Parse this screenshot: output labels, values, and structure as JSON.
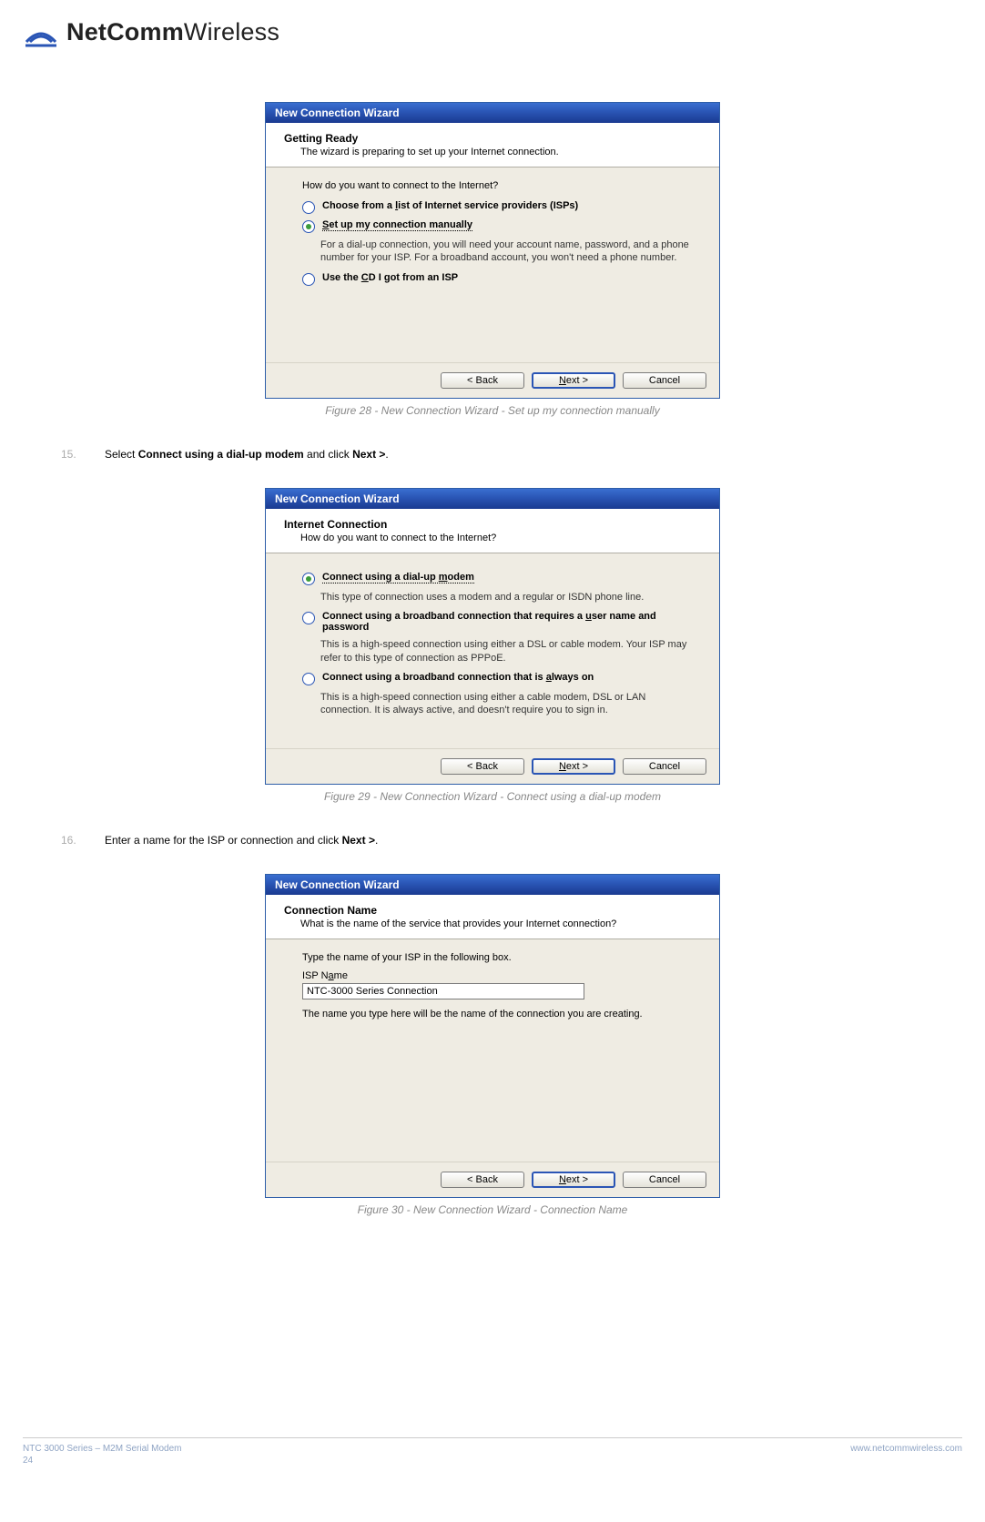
{
  "logo": {
    "bold": "NetComm",
    "light": "Wireless"
  },
  "figure28": {
    "caption": "Figure 28 - New Connection Wizard - Set up my connection manually",
    "titlebar": "New Connection Wizard",
    "head_title": "Getting Ready",
    "head_sub": "The wizard is preparing to set up your Internet connection.",
    "prompt": "How do you want to connect to the Internet?",
    "opt1_pre": "Choose from a ",
    "opt1_u": "l",
    "opt1_post": "ist of Internet service providers (ISPs)",
    "opt2_u": "S",
    "opt2_post": "et up my connection manually",
    "opt2_sub": "For a dial-up connection, you will need your account name, password, and a phone number for your ISP. For a broadband account, you won't need a phone number.",
    "opt3_pre": "Use the ",
    "opt3_u": "C",
    "opt3_post": "D I got from an ISP",
    "back": "< Back",
    "next": "Next >",
    "cancel": "Cancel"
  },
  "step15": {
    "num": "15.",
    "pre": "Select ",
    "b1": "Connect using a dial-up modem",
    "mid": " and click ",
    "b2": "Next >",
    "post": "."
  },
  "figure29": {
    "caption": "Figure 29 - New Connection Wizard - Connect using a dial-up modem",
    "titlebar": "New Connection Wizard",
    "head_title": "Internet Connection",
    "head_sub": "How do you want to connect to the Internet?",
    "opt1_pre": "Connect using a dial-up ",
    "opt1_u": "m",
    "opt1_post": "odem",
    "opt1_sub": "This type of connection uses a modem and a regular or ISDN phone line.",
    "opt2_pre": "Connect using a broadband connection that requires a ",
    "opt2_u": "u",
    "opt2_post": "ser name and password",
    "opt2_sub": "This is a high-speed connection using either a DSL or cable modem. Your ISP may refer to this type of connection as PPPoE.",
    "opt3_pre": "Connect using a broadband connection that is ",
    "opt3_u": "a",
    "opt3_post": "lways on",
    "opt3_sub": "This is a high-speed connection using either a cable modem, DSL or LAN connection. It is always active, and doesn't require you to sign in.",
    "back": "< Back",
    "next": "Next >",
    "cancel": "Cancel"
  },
  "step16": {
    "num": "16.",
    "pre": "Enter a name for the ISP or connection and click ",
    "b1": "Next >",
    "post": "."
  },
  "figure30": {
    "caption": "Figure 30 - New Connection Wizard - Connection Name",
    "titlebar": "New Connection Wizard",
    "head_title": "Connection Name",
    "head_sub": "What is the name of the service that provides your Internet connection?",
    "body1": "Type the name of your ISP in the following box.",
    "label": "ISP Name",
    "input_value": "NTC-3000 Series Connection",
    "note": "The name you type here will be the name of the connection you are creating.",
    "back": "< Back",
    "next": "Next >",
    "cancel": "Cancel"
  },
  "footer": {
    "left1": "NTC 3000 Series – M2M Serial Modem",
    "left2": "24",
    "right": "www.netcommwireless.com"
  }
}
